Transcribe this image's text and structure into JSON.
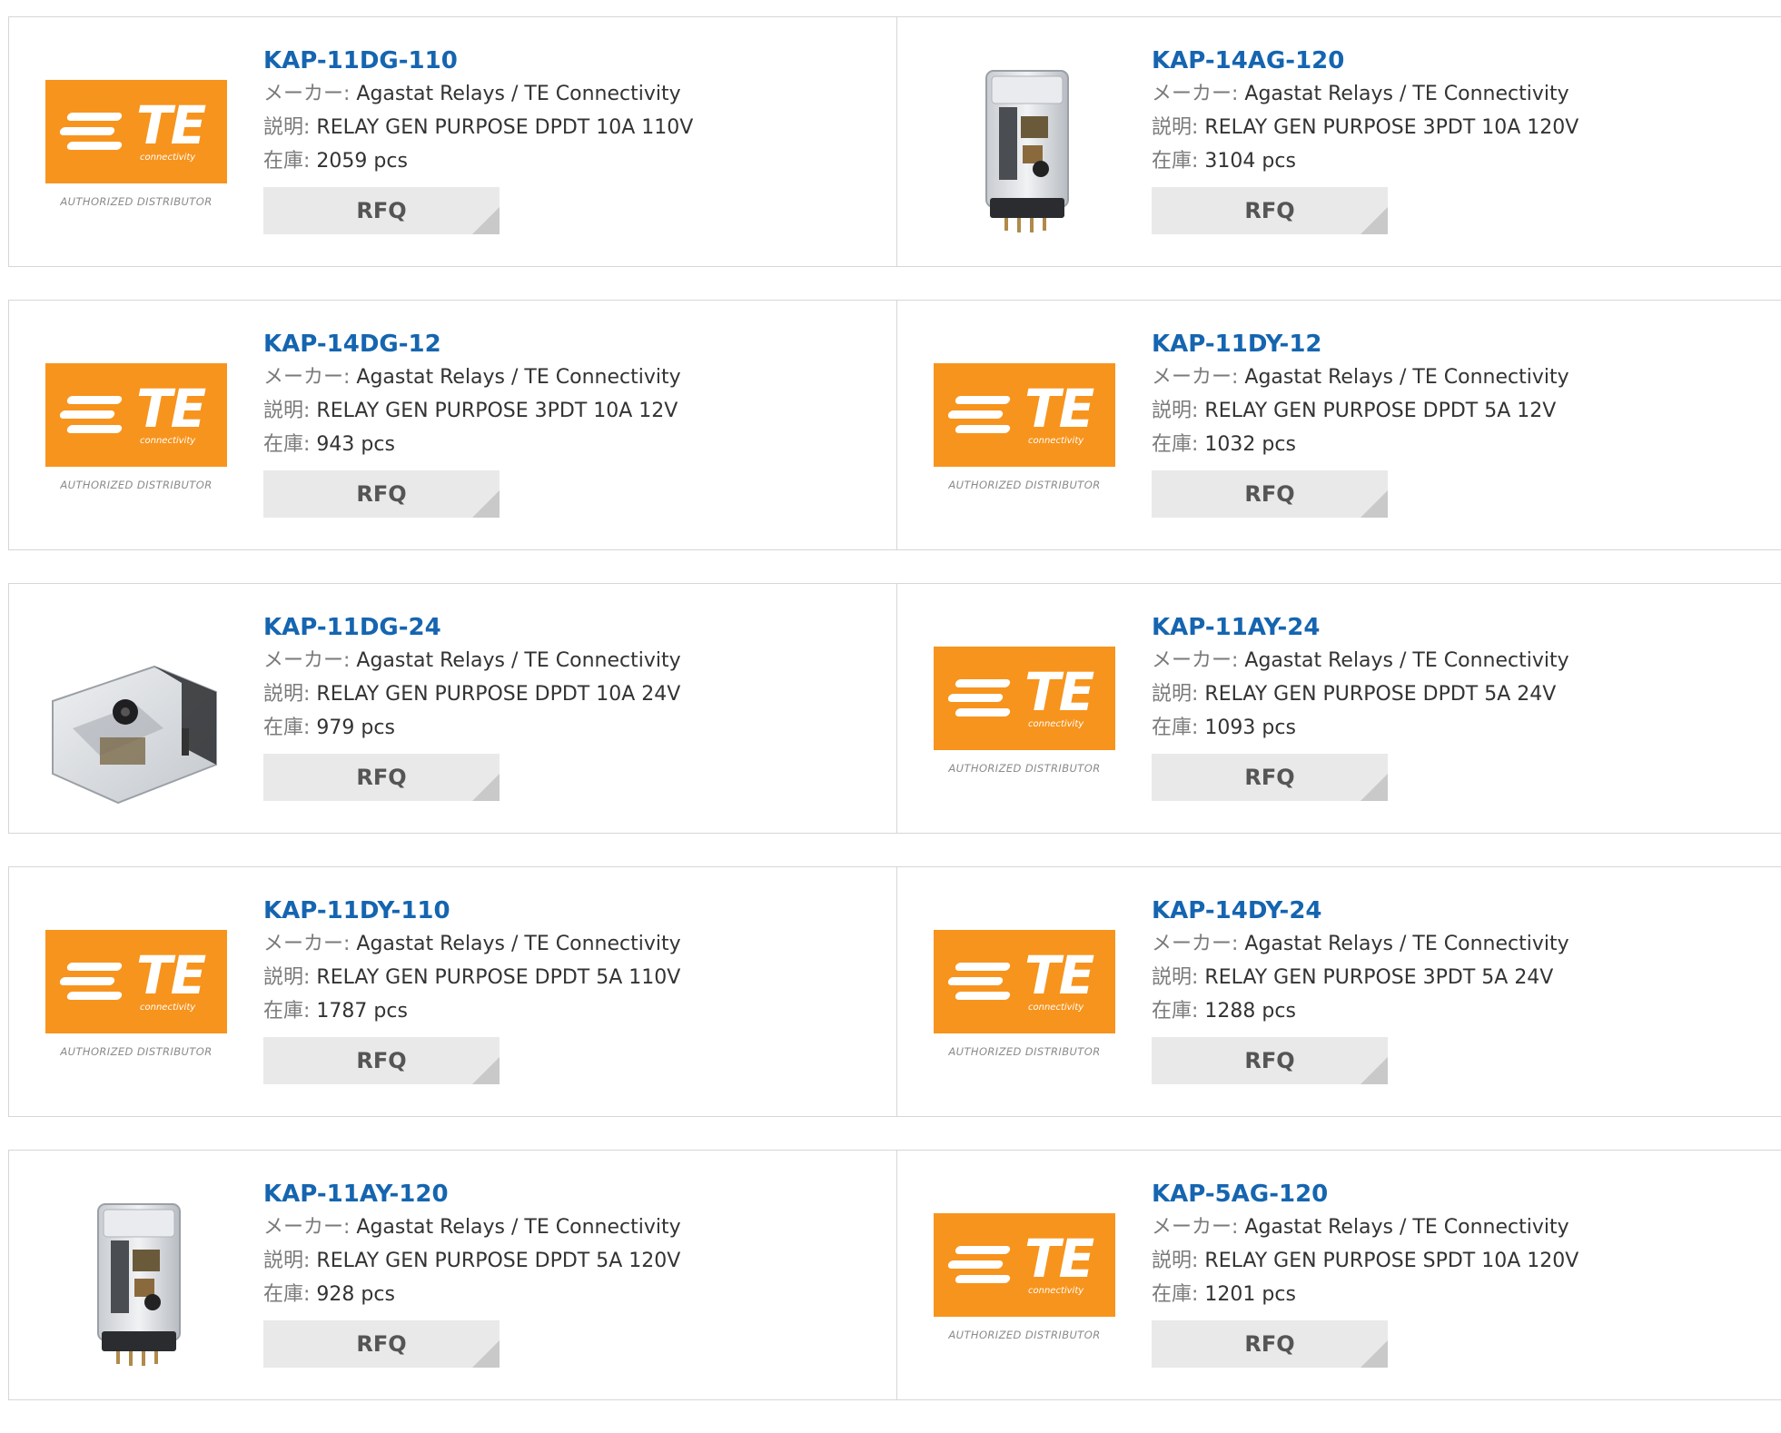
{
  "labels": {
    "maker": "メーカー:",
    "description": "説明:",
    "stock": "在庫:",
    "rfq": "RFQ"
  },
  "brand": {
    "logo_text": "TE",
    "logo_subtext": "connectivity",
    "logo_caption": "AUTHORIZED DISTRIBUTOR",
    "accent_color": "#f7941d",
    "link_color": "#1565b0"
  },
  "products": [
    {
      "part": "KAP-11DG-110",
      "maker": "Agastat Relays / TE Connectivity",
      "description": "RELAY GEN PURPOSE DPDT 10A 110V",
      "stock": "2059 pcs",
      "image": "te-logo"
    },
    {
      "part": "KAP-14AG-120",
      "maker": "Agastat Relays / TE Connectivity",
      "description": "RELAY GEN PURPOSE 3PDT 10A 120V",
      "stock": "3104 pcs",
      "image": "relay-tall"
    },
    {
      "part": "KAP-14DG-12",
      "maker": "Agastat Relays / TE Connectivity",
      "description": "RELAY GEN PURPOSE 3PDT 10A 12V",
      "stock": "943 pcs",
      "image": "te-logo"
    },
    {
      "part": "KAP-11DY-12",
      "maker": "Agastat Relays / TE Connectivity",
      "description": "RELAY GEN PURPOSE DPDT 5A 12V",
      "stock": "1032 pcs",
      "image": "te-logo"
    },
    {
      "part": "KAP-11DG-24",
      "maker": "Agastat Relays / TE Connectivity",
      "description": "RELAY GEN PURPOSE DPDT 10A 24V",
      "stock": "979 pcs",
      "image": "relay-side"
    },
    {
      "part": "KAP-11AY-24",
      "maker": "Agastat Relays / TE Connectivity",
      "description": "RELAY GEN PURPOSE DPDT 5A 24V",
      "stock": "1093 pcs",
      "image": "te-logo"
    },
    {
      "part": "KAP-11DY-110",
      "maker": "Agastat Relays / TE Connectivity",
      "description": "RELAY GEN PURPOSE DPDT 5A 110V",
      "stock": "1787 pcs",
      "image": "te-logo"
    },
    {
      "part": "KAP-14DY-24",
      "maker": "Agastat Relays / TE Connectivity",
      "description": "RELAY GEN PURPOSE 3PDT 5A 24V",
      "stock": "1288 pcs",
      "image": "te-logo"
    },
    {
      "part": "KAP-11AY-120",
      "maker": "Agastat Relays / TE Connectivity",
      "description": "RELAY GEN PURPOSE DPDT 5A 120V",
      "stock": "928 pcs",
      "image": "relay-tall"
    },
    {
      "part": "KAP-5AG-120",
      "maker": "Agastat Relays / TE Connectivity",
      "description": "RELAY GEN PURPOSE SPDT 10A 120V",
      "stock": "1201 pcs",
      "image": "te-logo"
    }
  ]
}
